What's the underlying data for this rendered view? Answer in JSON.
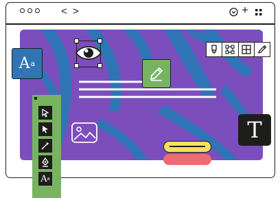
{
  "titlebar": {
    "window_dots": [
      "dot",
      "dot",
      "dot"
    ],
    "back_label": "<",
    "forward_label": ">",
    "plus_label": "+",
    "icons": [
      "chevron-down-circle-icon",
      "plus-icon",
      "grid-icon"
    ]
  },
  "canvas": {
    "background_colors": {
      "base": "#7c4dbd",
      "stripe": "#2f74b5"
    },
    "text_lines": 3
  },
  "text_tile": {
    "label": "A",
    "superscript": "a",
    "color": "#2f74b5"
  },
  "type_tile": {
    "label": "T",
    "color": "#1d1d1b"
  },
  "pencil_tile": {
    "icon": "pencil-icon",
    "color": "#78b361"
  },
  "top_toolbar": {
    "icons": [
      "marker-icon",
      "select-nodes-icon",
      "grid-icon",
      "eyedropper-icon"
    ]
  },
  "sidebar": {
    "color": "#78b361",
    "tools": [
      "select-outline-icon",
      "select-icon",
      "magic-wand-icon",
      "pen-tool-icon",
      "text-tool-icon"
    ],
    "text_tool_label": "A",
    "text_tool_superscript": "a"
  },
  "buttons": {
    "primary_color": "#f7e15b",
    "secondary_color": "#ef6a73"
  }
}
